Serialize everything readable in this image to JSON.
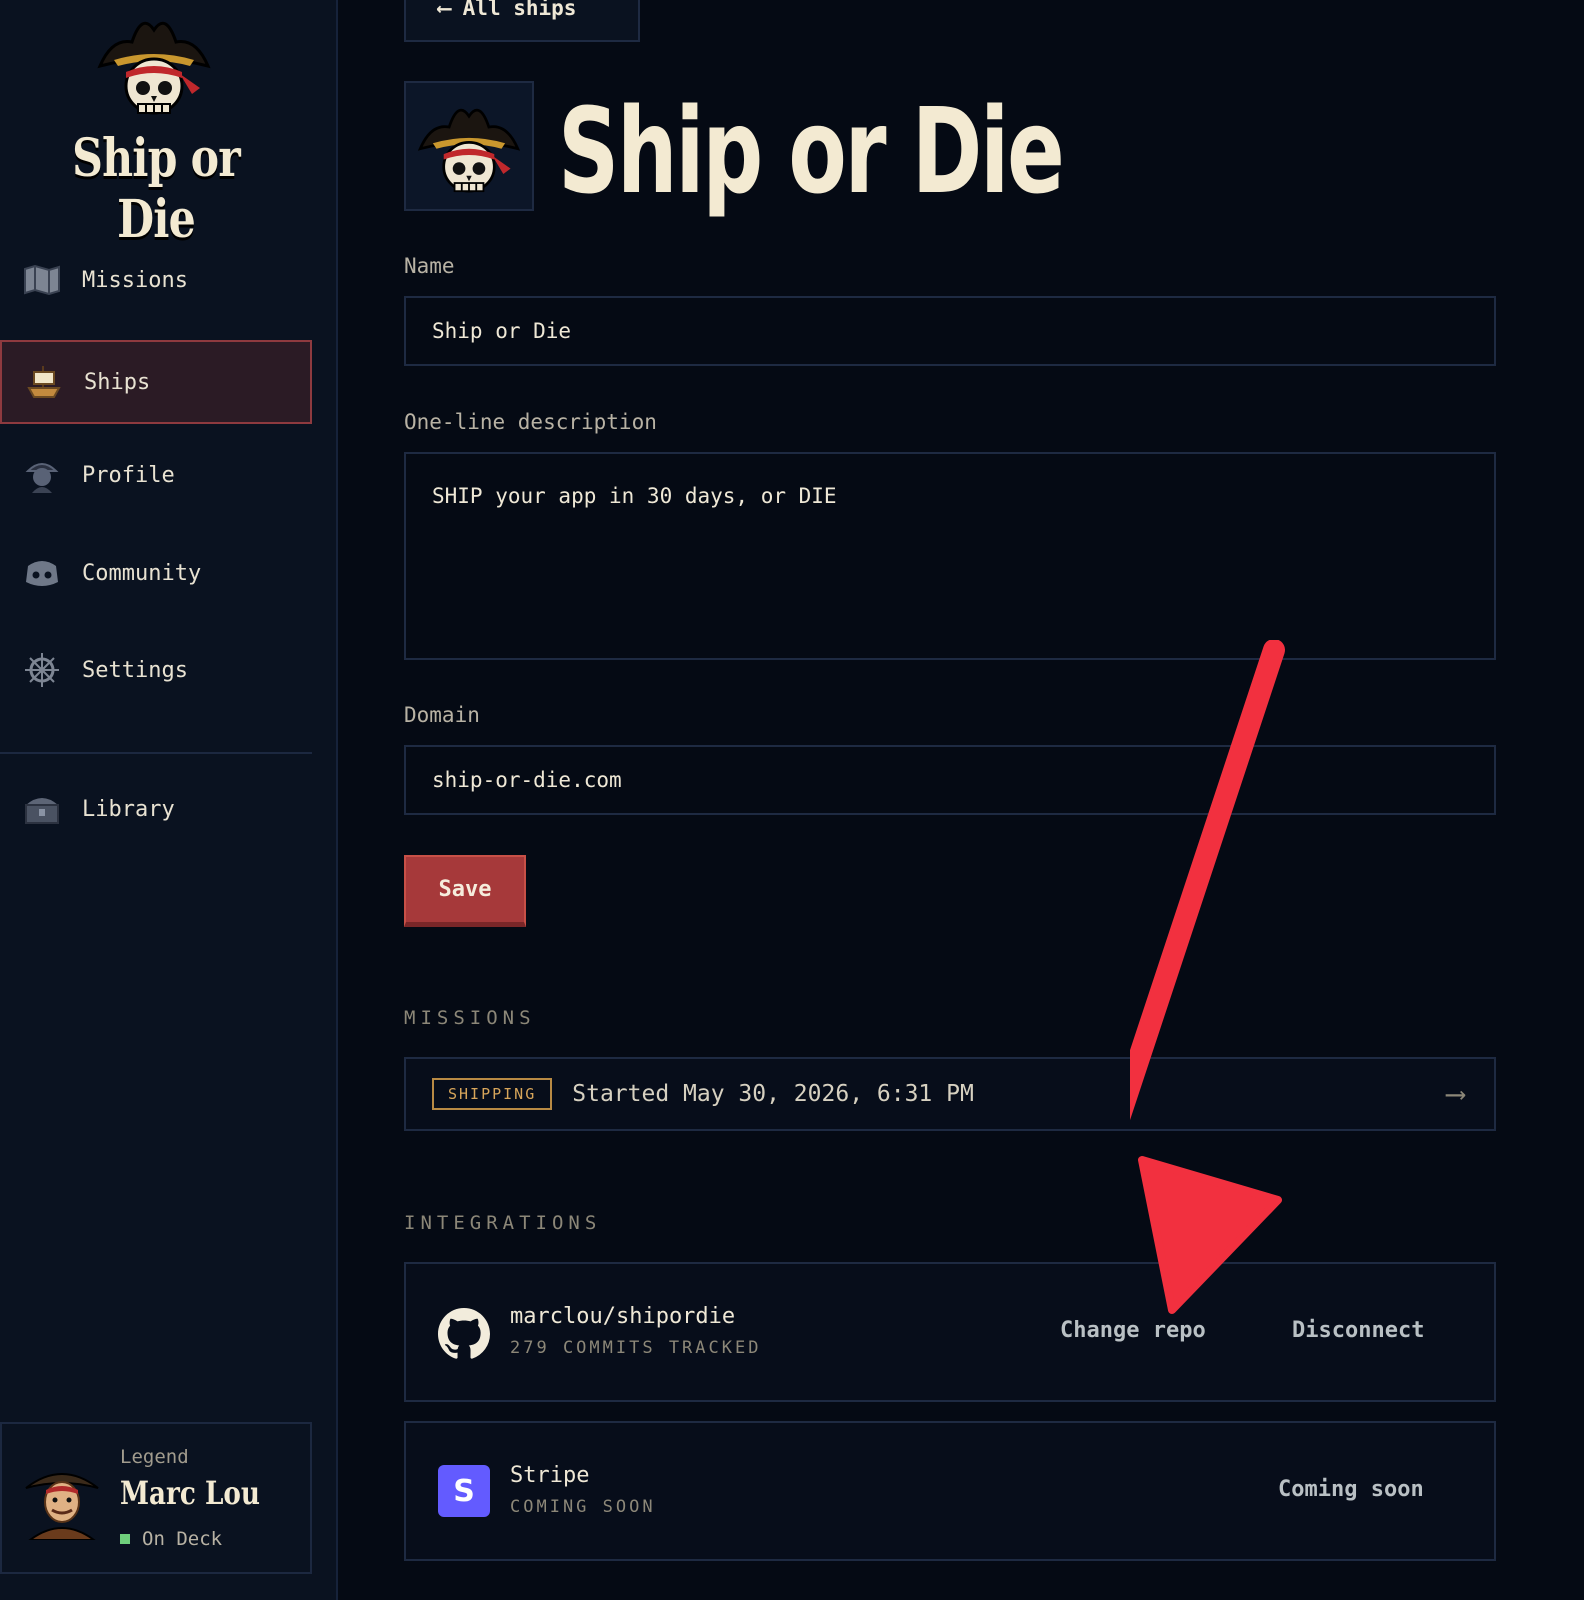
{
  "brand": {
    "title": "Ship or Die"
  },
  "sidebar": {
    "items": [
      {
        "label": "Missions",
        "icon": "map-icon"
      },
      {
        "label": "Ships",
        "icon": "ship-icon",
        "active": true
      },
      {
        "label": "Profile",
        "icon": "pirate-profile-icon"
      },
      {
        "label": "Community",
        "icon": "discord-icon"
      },
      {
        "label": "Settings",
        "icon": "ship-wheel-icon"
      },
      {
        "label": "Library",
        "icon": "treasure-chest-icon"
      }
    ]
  },
  "user": {
    "role": "Legend",
    "name": "Marc Lou",
    "status": "On Deck",
    "status_color": "#6fcf7c"
  },
  "main": {
    "back_label": "All ships",
    "title": "Ship or Die",
    "form": {
      "name_label": "Name",
      "name_value": "Ship or Die",
      "description_label": "One-line description",
      "description_value": "SHIP your app in 30 days, or DIE",
      "domain_label": "Domain",
      "domain_value": "ship-or-die.com",
      "save_label": "Save"
    },
    "missions": {
      "heading": "MISSIONS",
      "items": [
        {
          "badge": "SHIPPING",
          "text": "Started May 30, 2026, 6:31 PM"
        }
      ]
    },
    "integrations": {
      "heading": "INTEGRATIONS",
      "github": {
        "name": "marclou/shipordie",
        "sub": "279 COMMITS TRACKED",
        "change_label": "Change repo",
        "disconnect_label": "Disconnect"
      },
      "stripe": {
        "logo_letter": "S",
        "name": "Stripe",
        "sub": "COMING SOON",
        "action_label": "Coming soon"
      }
    }
  },
  "colors": {
    "background": "#050a14",
    "sidebar": "#0a1220",
    "accent_red": "#a6393a",
    "cream": "#f3ead2",
    "badge": "#d7a55a",
    "stripe": "#635bff",
    "annotation": "#f2303f"
  }
}
